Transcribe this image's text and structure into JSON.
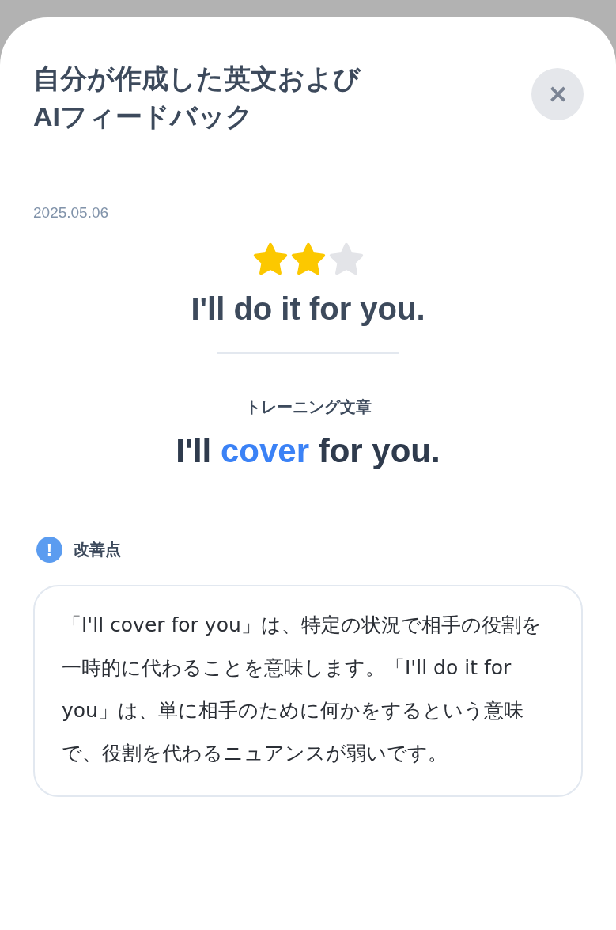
{
  "sheet": {
    "title": "自分が作成した英文および\nAIフィードバック",
    "close_label": "✕"
  },
  "date": "2025.05.06",
  "rating": {
    "stars": 2
  },
  "user_sentence": "I'll do it for you.",
  "training": {
    "label": "トレーニング文章",
    "parts": [
      {
        "text": "I'll ",
        "highlighted": false
      },
      {
        "text": "cover",
        "highlighted": true
      },
      {
        "text": " for you.",
        "highlighted": false
      }
    ]
  },
  "improvement": {
    "label": "改善点",
    "icon": "!",
    "text": "「I'll cover for you」は、特定の状況で相手の役割を一時的に代わることを意味します。「I'll do it for you」は、単に相手のために何かをするという意味で、役割を代わるニュアンスが弱いです。"
  }
}
